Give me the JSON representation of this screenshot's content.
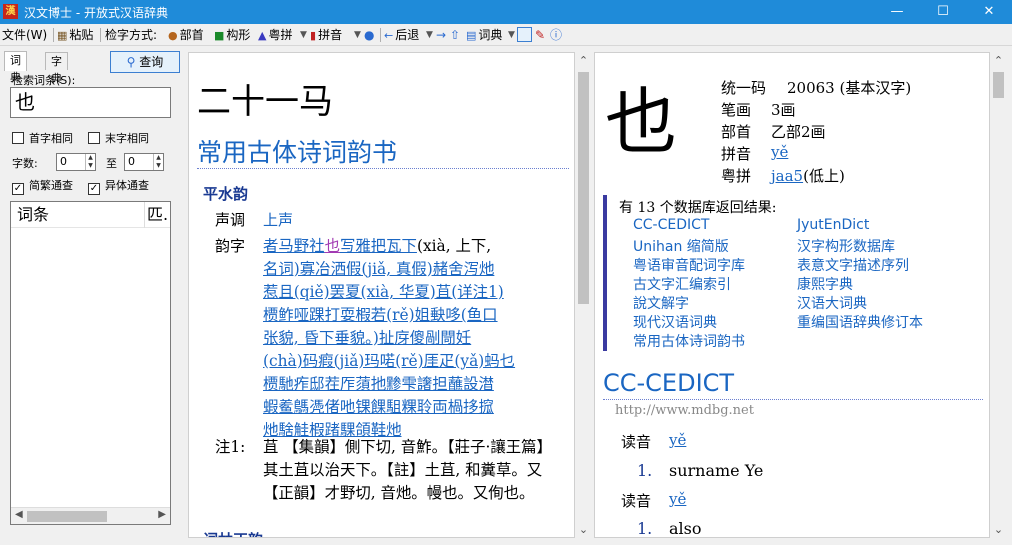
{
  "window": {
    "title": "汉文博士 - 开放式汉语辞典",
    "app_icon": "漢"
  },
  "toolbar": {
    "file": "文件(W)",
    "paste": "粘贴",
    "mode_label": "检字方式:",
    "bushou": "部首",
    "goujian": "构形",
    "yuepin": "粤拼",
    "pinyin": "拼音",
    "back": "后退",
    "cidian": "词典"
  },
  "left": {
    "tab_ci": "词典",
    "tab_zi": "字典",
    "query": "查询",
    "search_label": "检索词条(S):",
    "search_value": "也",
    "head_same": "首字相同",
    "tail_same": "末字相同",
    "count_label": "字数:",
    "count_from": "0",
    "to_label": "至",
    "count_to": "0",
    "jianfan": "简繁通查",
    "yiti": "异体通查",
    "col_entry": "词条",
    "col_match": "匹."
  },
  "middle": {
    "word": "二十一马",
    "dict_title": "常用古体诗词韵书",
    "section": "平水韵",
    "tone_key": "声调",
    "tone_val": "上声",
    "rhyme_key": "韵字",
    "rhyme_lines": [
      [
        "",
        "者马野社"
      ],
      [
        "h",
        "也"
      ],
      [
        "",
        "写雅把瓦下"
      ],
      [
        "t",
        "(xià, 上下,"
      ]
    ],
    "rhyme_body": [
      "名词)寡冶洒假(jiǎ, 真假)赭舍泻灺",
      "惹且(qiě)罢夏(xià, 华夏)苴(详注1)",
      "槚鲊哑踝打耍椵若(rě)姐𡙇哆(鱼口",
      "张貌, 昏下垂貌。)扯庌傻剮閜妊",
      "(chà)码瘕(jiǎ)玛喏(rě)厓疋(yǎ)蚂乜",
      "槚馳痄邸茬厏蕦扡黪雫譇担蘸設澘",
      "蝦鲝鷌凴偖吔锞餜駔粿聆両楇拸搲",
      "灺騇觟椵踷騍頜鞋灺"
    ],
    "note_key": "注1:",
    "note_text": "苴 【集韻】側下切, 音鮓。【莊子·讓王篇】其土苴以治天下。【註】土苴, 和糞草。又【正韻】才野切, 音灺。幔也。又侚也。",
    "next_section": "词林正韵"
  },
  "right": {
    "char": "也",
    "codepoint_key": "统一码",
    "codepoint_val": "20063 (基本汉字)",
    "strokes_key": "笔画",
    "strokes_val": "3画",
    "radical_key": "部首",
    "radical_val": "乙部2画",
    "pinyin_key": "拼音",
    "pinyin_val": "yě",
    "jyut_key": "粤拼",
    "jyut_val": "jaa5",
    "jyut_note": "(低上)",
    "db_head": "有 13 个数据库返回结果:",
    "db_col1": [
      "CC-CEDICT",
      "Unihan 缩简版",
      "粤语审音配词字库",
      "古文字汇编索引",
      "說文解字",
      "现代汉语词典",
      "常用古体诗词韵书"
    ],
    "db_col2": [
      "JyutEnDict",
      "汉字构形数据库",
      "表意文字描述序列",
      "康熙字典",
      "汉语大词典",
      "重编国语辞典修订本"
    ],
    "cedict_title": "CC-CEDICT",
    "cedict_url": "http://www.mdbg.net",
    "reading_label": "读音",
    "reading1": "yě",
    "def1_num": "1.",
    "def1": "surname Ye",
    "reading2": "yě",
    "def2_num": "1.",
    "def2": "also"
  },
  "colors": {
    "titlebar": "#1f8bd9",
    "link": "#1a66c2",
    "heading": "#1a3a92",
    "highlight": "#a23bb3"
  }
}
